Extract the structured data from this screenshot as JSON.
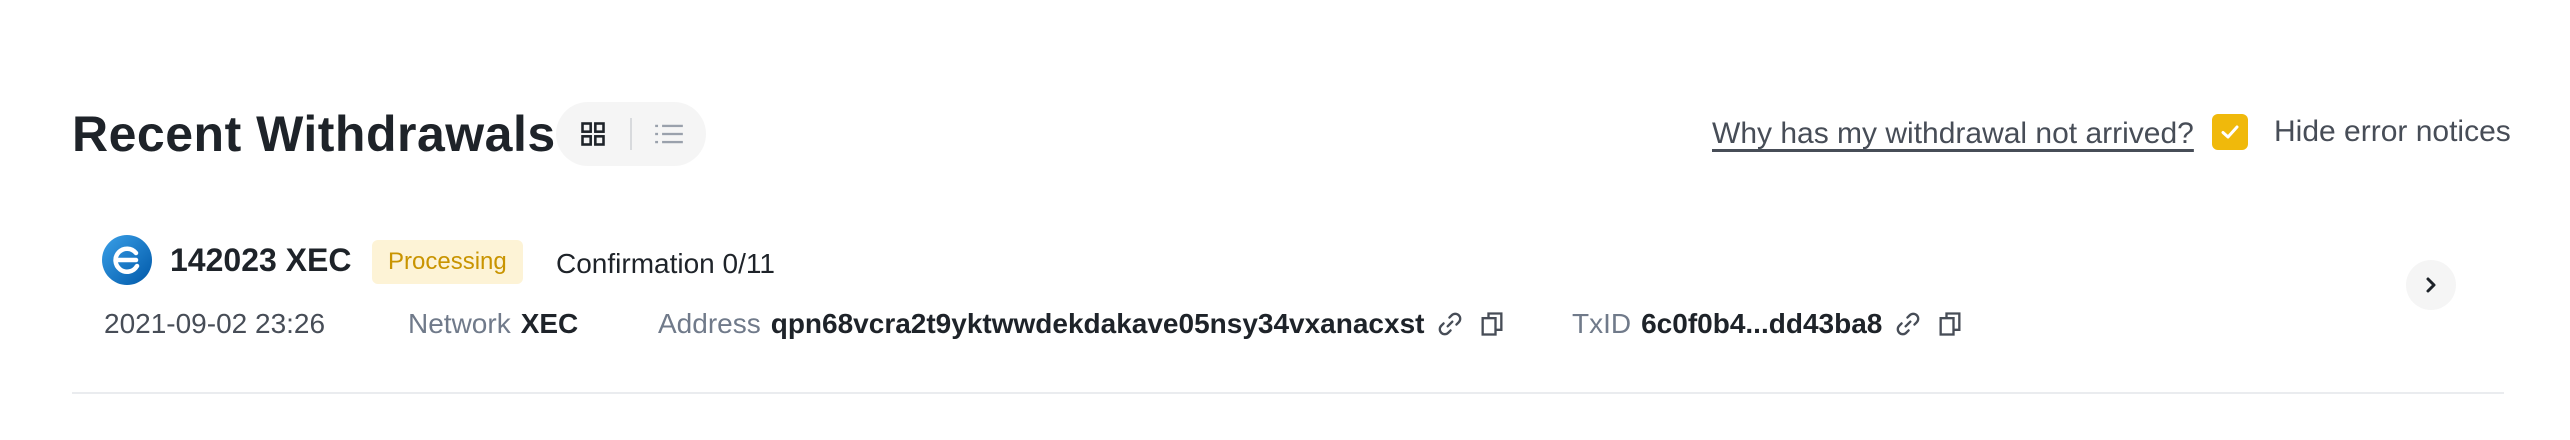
{
  "header": {
    "title": "Recent Withdrawals",
    "view_modes": [
      "grid",
      "list"
    ],
    "help_link": "Why has my withdrawal not arrived?",
    "hide_errors": {
      "label": "Hide error notices",
      "checked": true
    }
  },
  "withdrawal": {
    "coin_icon": "ecash-icon",
    "amount": "142023 XEC",
    "status": "Processing",
    "confirmation": "Confirmation 0/11",
    "date": "2021-09-02 23:26",
    "network_label": "Network",
    "network_value": "XEC",
    "address_label": "Address",
    "address_value": "qpn68vcra2t9yktwwdekdakave05nsy34vxanacxst",
    "txid_label": "TxID",
    "txid_value": "6c0f0b4...dd43ba8"
  },
  "colors": {
    "accent": "#f0b90b",
    "badge_bg": "#fdf3d6",
    "badge_text": "#c99400",
    "muted_text": "#707a8a",
    "divider": "#eaecef",
    "coin_blue": "#0074c2"
  }
}
